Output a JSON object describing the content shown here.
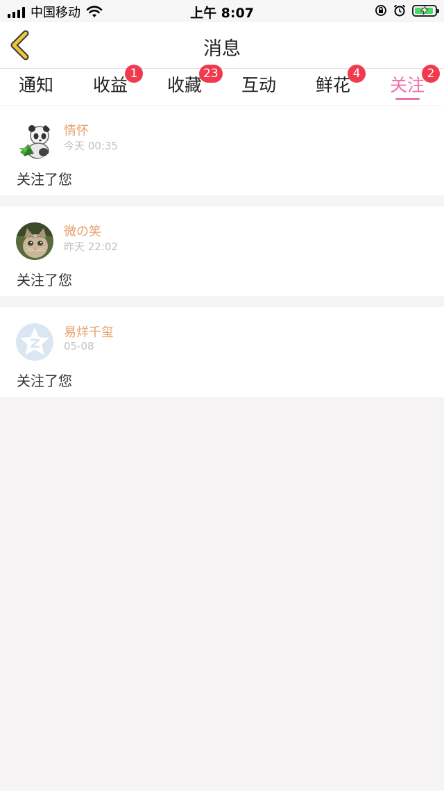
{
  "status_bar": {
    "carrier": "中国移动",
    "time": "上午 8:07",
    "icons": [
      "signal-icon",
      "wifi-icon",
      "rotation-lock-icon",
      "alarm-icon",
      "battery-charging-icon"
    ],
    "battery_color": "#4cd964"
  },
  "header": {
    "title": "消息",
    "back_icon": "chevron-left-icon",
    "accent_color": "#f0c53a"
  },
  "tabs": [
    {
      "label": "通知",
      "badge": ""
    },
    {
      "label": "收益",
      "badge": "1"
    },
    {
      "label": "收藏",
      "badge": "23"
    },
    {
      "label": "互动",
      "badge": ""
    },
    {
      "label": "鲜花",
      "badge": "4"
    },
    {
      "label": "关注",
      "badge": "2",
      "active": true
    }
  ],
  "colors": {
    "active_tab": "#ef6fa6",
    "badge": "#f23a4f",
    "username": "#e8a06a"
  },
  "messages": [
    {
      "username": "情怀",
      "time": "今天 00:35",
      "text": "关注了您",
      "avatar": "panda-avatar"
    },
    {
      "username": "微の笑",
      "time": "昨天 22:02",
      "text": "关注了您",
      "avatar": "cat-photo-avatar"
    },
    {
      "username": "易烊千玺",
      "time": "05-08",
      "text": "关注了您",
      "avatar": "qzone-star-avatar"
    }
  ]
}
